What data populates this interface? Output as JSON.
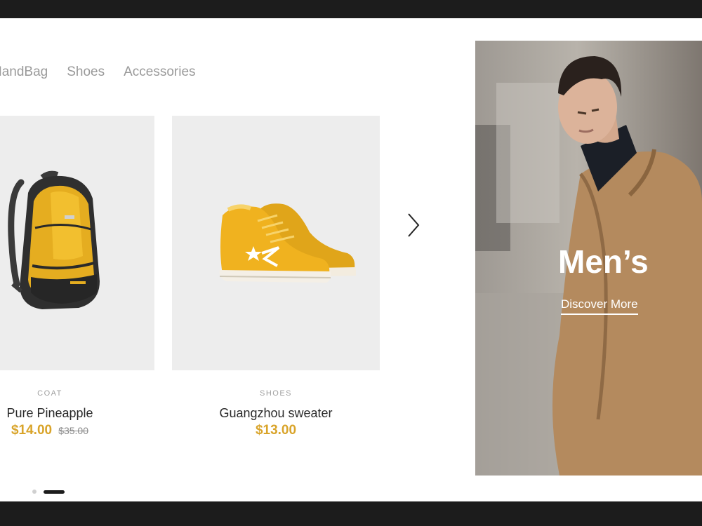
{
  "tabs": [
    "HandBag",
    "Shoes",
    "Accessories"
  ],
  "products": [
    {
      "category": "COAT",
      "name": "Pure Pineapple",
      "price": "$14.00",
      "old_price": "$35.00",
      "image": "yellow-backpack"
    },
    {
      "category": "SHOES",
      "name": "Guangzhou sweater",
      "price": "$13.00",
      "old_price": "",
      "image": "yellow-sneakers"
    }
  ],
  "carousel": {
    "next_icon": "chevron-right-icon",
    "active_page": 2,
    "page_count": 2
  },
  "promo": {
    "title": "Men’s",
    "link_label": "Discover More",
    "image": "man-in-camel-coat"
  },
  "colors": {
    "accent_price": "#d9a42a",
    "frame": "#1c1c1c",
    "card_bg": "#ededed",
    "tab_text": "#9a9a9a"
  }
}
